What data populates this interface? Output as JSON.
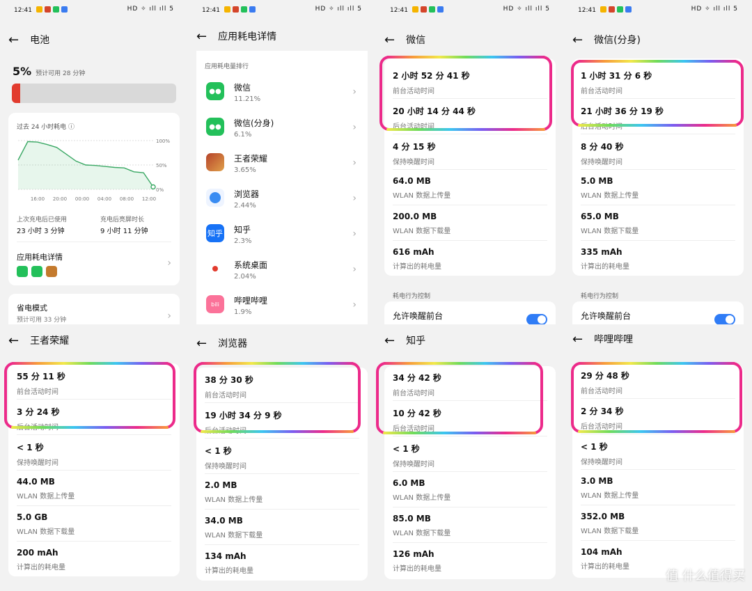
{
  "status": {
    "time": "12:41",
    "sys": "HD ✧ ıll ıll 5"
  },
  "battery": {
    "title": "电池",
    "percent": "5%",
    "estimate": "预计可用 28 分钟",
    "level": 0.05,
    "chart_title": "过去 24 小时耗电",
    "y_ticks": [
      "100%",
      "50%",
      "0%"
    ],
    "x_ticks": [
      "16:00",
      "20:00",
      "00:00",
      "04:00",
      "08:00",
      "12:00"
    ],
    "last_charge_label": "上次充电后已使用",
    "last_charge_value": "23 小时 3 分钟",
    "screen_on_label": "充电后亮屏时长",
    "screen_on_value": "9 小时 11 分钟",
    "details_label": "应用耗电详情",
    "saver_label": "省电模式",
    "saver_estimate": "预计可用 33 分钟"
  },
  "chart_data": {
    "type": "line",
    "title": "过去 24 小时耗电",
    "x": [
      "14:00",
      "15:00",
      "16:00",
      "18:00",
      "20:00",
      "21:00",
      "22:00",
      "00:00",
      "02:00",
      "04:00",
      "06:00",
      "08:00",
      "10:00",
      "11:00",
      "12:00"
    ],
    "y": [
      60,
      98,
      97,
      92,
      86,
      72,
      58,
      50,
      49,
      47,
      45,
      44,
      36,
      34,
      5
    ],
    "ylim": [
      0,
      100
    ],
    "y_ticks": [
      "100%",
      "50%",
      "0%"
    ],
    "x_ticks": [
      "16:00",
      "20:00",
      "00:00",
      "04:00",
      "08:00",
      "12:00"
    ]
  },
  "ranking": {
    "title": "应用耗电详情",
    "section": "应用耗电量排行",
    "apps": [
      {
        "name": "微信",
        "pct": "11.21%"
      },
      {
        "name": "微信(分身)",
        "pct": "6.1%"
      },
      {
        "name": "王者荣耀",
        "pct": "3.65%"
      },
      {
        "name": "浏览器",
        "pct": "2.44%"
      },
      {
        "name": "知乎",
        "pct": "2.3%"
      },
      {
        "name": "系统桌面",
        "pct": "2.04%"
      },
      {
        "name": "哔哩哔哩",
        "pct": "1.9%"
      }
    ]
  },
  "labels": {
    "fg": "前台活动时间",
    "bg": "后台活动时间",
    "wake": "保持唤醒时间",
    "up": "WLAN 数据上传量",
    "down": "WLAN 数据下载量",
    "mah": "计算出的耗电量",
    "control": "耗电行为控制",
    "allow": "允许唤醒前台"
  },
  "details": [
    {
      "title": "微信",
      "fg": "2 小时 52 分 41 秒",
      "bg": "20 小时 14 分 44 秒",
      "wake": "4 分 15 秒",
      "up": "64.0 MB",
      "down": "200.0 MB",
      "mah": "616 mAh"
    },
    {
      "title": "微信(分身)",
      "fg": "1 小时 31 分 6 秒",
      "bg": "21 小时 36 分 19 秒",
      "wake": "8 分 40 秒",
      "up": "5.0 MB",
      "down": "65.0 MB",
      "mah": "335 mAh"
    },
    {
      "title": "王者荣耀",
      "fg": "55 分 11 秒",
      "bg": "3 分 24 秒",
      "wake": "< 1 秒",
      "up": "44.0 MB",
      "down": "5.0 GB",
      "mah": "200 mAh"
    },
    {
      "title": "浏览器",
      "fg": "38 分 30 秒",
      "bg": "19 小时 34 分 9 秒",
      "wake": "< 1 秒",
      "up": "2.0 MB",
      "down": "34.0 MB",
      "mah": "134 mAh"
    },
    {
      "title": "知乎",
      "fg": "34 分 42 秒",
      "bg": "10 分 42 秒",
      "wake": "< 1 秒",
      "up": "6.0 MB",
      "down": "85.0 MB",
      "mah": "126 mAh"
    },
    {
      "title": "哔哩哔哩",
      "fg": "29 分 48 秒",
      "bg": "2 分 34 秒",
      "wake": "< 1 秒",
      "up": "3.0 MB",
      "down": "352.0 MB",
      "mah": "104 mAh"
    }
  ],
  "watermark": "值 什么值得买"
}
